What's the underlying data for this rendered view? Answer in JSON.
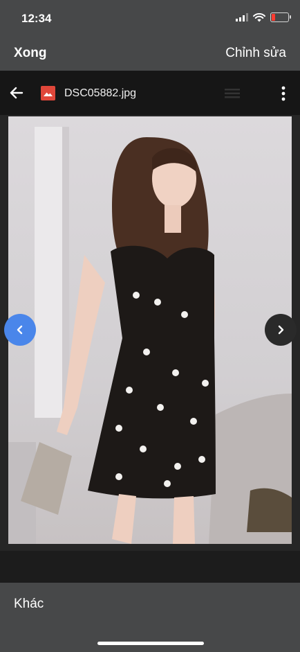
{
  "status_bar": {
    "time": "12:34",
    "battery_color": "#ff3b30",
    "battery_level": 0.2
  },
  "nav": {
    "done_label": "Xong",
    "edit_label": "Chỉnh sửa"
  },
  "viewer": {
    "file_name": "DSC05882.jpg",
    "file_icon_color": "#e0473a",
    "icons": [
      "back-arrow-icon",
      "image-file-icon",
      "list-icon",
      "more-vert-icon"
    ]
  },
  "navigation": {
    "prev_icon": "chevron-left-icon",
    "prev_color": "#4a86ea",
    "next_icon": "chevron-right-icon",
    "next_color": "#2a2a2a"
  },
  "bottom": {
    "more_label": "Khác"
  }
}
